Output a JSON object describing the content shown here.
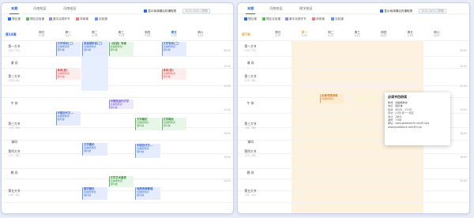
{
  "colors": {
    "accent": "#2f6be0",
    "legend": [
      "#2f6be0",
      "#63b863",
      "#9a86e4",
      "#f0a950",
      "#ef7b7b",
      "#6b96ef"
    ]
  },
  "tabs": [
    "本期",
    "河南校区",
    "河南校区"
  ],
  "tabs_right": [
    "本期",
    "河南校区",
    "理学校区"
  ],
  "legend": [
    "理论课",
    "理论实验课",
    "集中实践环节",
    "体育课",
    "实验课"
  ],
  "legend_right": [
    "理论课",
    "理论实验课",
    "集中实践环节",
    "体育课",
    "实验课"
  ],
  "check_label": "显示我调课后的课程表",
  "semester": "2024-2025-2学期",
  "week_label_left": "第14周",
  "week_label_right": "第7周",
  "days_left": [
    {
      "name": "周日",
      "date": "3-16"
    },
    {
      "name": "周一",
      "date": "3-17"
    },
    {
      "name": "周二",
      "date": "3-18"
    },
    {
      "name": "周三",
      "date": "3-19"
    },
    {
      "name": "周四",
      "date": "3-20"
    },
    {
      "name": "周五",
      "date": "3-21"
    },
    {
      "name": "周六",
      "date": "3-22"
    }
  ],
  "days_right": [
    {
      "name": "周日",
      "date": "3-30"
    },
    {
      "name": "周一",
      "date": "3-31"
    },
    {
      "name": "周二",
      "date": "4-01"
    },
    {
      "name": "周三",
      "date": "4-02"
    },
    {
      "name": "周四",
      "date": "4-03"
    },
    {
      "name": "周五",
      "date": "4-04"
    },
    {
      "name": "周六",
      "date": "4-05"
    }
  ],
  "periods": [
    {
      "name": "第一大节",
      "time": "(01、02)"
    },
    {
      "name": "课 间",
      "time": ""
    },
    {
      "name": "第二大节",
      "time": "(03、04)"
    },
    {
      "name": "午 休",
      "time": ""
    },
    {
      "name": "第三大节",
      "time": "(05、06)"
    },
    {
      "name": "课间",
      "time": ""
    },
    {
      "name": "第四大节",
      "time": "(07、08)"
    },
    {
      "name": "晚 间",
      "time": ""
    },
    {
      "name": "第五大节",
      "time": "(09、10)"
    }
  ],
  "times": [
    "08:00",
    "10:00",
    "12:00",
    "14:00",
    "16:00",
    "18:00",
    "20:00"
  ],
  "events_left": [
    {
      "title": "文学导论(二)",
      "sub": "钱樾楷教授",
      "room": "理科楼",
      "color": "blue"
    },
    {
      "title": "英语视听说(二)",
      "sub": "钱樾楷教授",
      "room": "理科楼",
      "color": "blue"
    },
    {
      "title": "《论语》导读",
      "sub": "钱樾楷教授",
      "room": "理科楼",
      "color": "green"
    },
    {
      "title": "文学导论(二)",
      "sub": "钱樾楷教授",
      "room": "理科楼",
      "color": "blue"
    },
    {
      "title": "体育(四)",
      "sub": "钱樾楷教授",
      "room": "理科楼",
      "color": "red"
    },
    {
      "title": "体育(四)",
      "sub": "钱樾楷教授",
      "room": "理科楼",
      "color": "red"
    },
    {
      "title": "中国现当代文学",
      "sub": "钱樾楷教授",
      "room": "理科楼",
      "color": "purple"
    },
    {
      "title": "中国古代文...",
      "sub": "钱樾楷教授",
      "room": "理科楼",
      "color": "blue"
    },
    {
      "title": "文学概论",
      "sub": "钱樾楷教授",
      "room": "理科楼",
      "color": "green"
    },
    {
      "title": "文学概论",
      "sub": "钱樾楷教授",
      "room": "理科楼",
      "color": "green"
    },
    {
      "title": "文学概论",
      "sub": "钱樾楷教授",
      "room": "理科楼",
      "color": "blue"
    },
    {
      "title": "中国古代文...",
      "sub": "钱樾楷教授",
      "room": "理科楼",
      "color": "blue"
    },
    {
      "title": "文学艺术鉴赏",
      "sub": "钱樾楷教授",
      "room": "理科楼",
      "color": "green"
    },
    {
      "title": "国学概论",
      "sub": "钱樾楷教授",
      "room": "理科楼",
      "color": "blue"
    },
    {
      "title": "地质资源管理",
      "sub": "钱樾楷教授",
      "room": "理科楼",
      "color": "blue"
    }
  ],
  "event_right": {
    "title": "必读书目研读",
    "sub": "钱樾楷教授"
  },
  "tooltip": {
    "title": "必读书目研读",
    "lines": [
      "教师：钱樾楷教授",
      "地点：理科楼",
      "时间：08:00 - 17:50",
      "周次：(7周) 周一~周五",
      "学分：2学分",
      "课号：7708",
      "网址：www.gxdataeclt.com/R.hyia",
      "www.gxdataeclt.com/R.hyia"
    ]
  }
}
